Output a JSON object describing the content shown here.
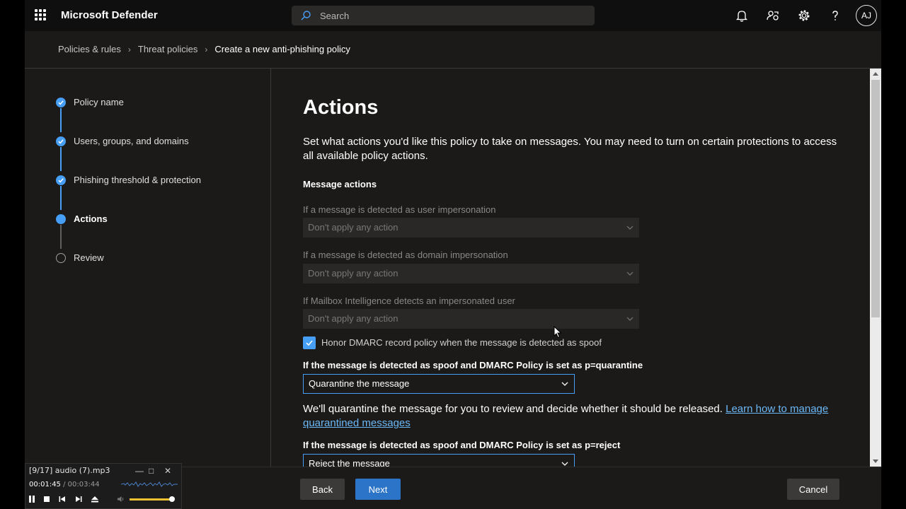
{
  "app": {
    "title": "Microsoft Defender",
    "search_placeholder": "Search",
    "avatar_initials": "AJ"
  },
  "breadcrumb": [
    "Policies & rules",
    "Threat policies",
    "Create a new anti-phishing policy"
  ],
  "steps": [
    {
      "label": "Policy name",
      "state": "done"
    },
    {
      "label": "Users, groups, and domains",
      "state": "done"
    },
    {
      "label": "Phishing threshold & protection",
      "state": "done"
    },
    {
      "label": "Actions",
      "state": "current"
    },
    {
      "label": "Review",
      "state": "pending"
    }
  ],
  "content": {
    "title": "Actions",
    "description": "Set what actions you'd like this policy to take on messages. You may need to turn on certain protections to access all available policy actions.",
    "section_title": "Message actions",
    "user_impersonation": {
      "label": "If a message is detected as user impersonation",
      "value": "Don't apply any action"
    },
    "domain_impersonation": {
      "label": "If a message is detected as domain impersonation",
      "value": "Don't apply any action"
    },
    "mailbox_intelligence": {
      "label": "If Mailbox Intelligence detects an impersonated user",
      "value": "Don't apply any action"
    },
    "honor_dmarc": {
      "label": "Honor DMARC record policy when the message is detected as spoof",
      "checked": true
    },
    "quarantine_policy": {
      "label": "If the message is detected as spoof and DMARC Policy is set as p=quarantine",
      "value": "Quarantine the message"
    },
    "quarantine_info": "We'll quarantine the message for you to review and decide whether it should be released.",
    "quarantine_link": "Learn how to manage quarantined messages",
    "reject_policy": {
      "label": "If the message is detected as spoof and DMARC Policy is set as p=reject",
      "value": "Reject the message"
    }
  },
  "footer": {
    "back": "Back",
    "next": "Next",
    "cancel": "Cancel"
  },
  "player": {
    "title": "[9/17] audio (7).mp3",
    "elapsed": "00:01:45",
    "separator": "/",
    "total": "00:03:44",
    "volume": 0.88
  },
  "colors": {
    "accent": "#479ef5",
    "primary_button": "#2b74c7",
    "link": "#6cb8f6"
  }
}
